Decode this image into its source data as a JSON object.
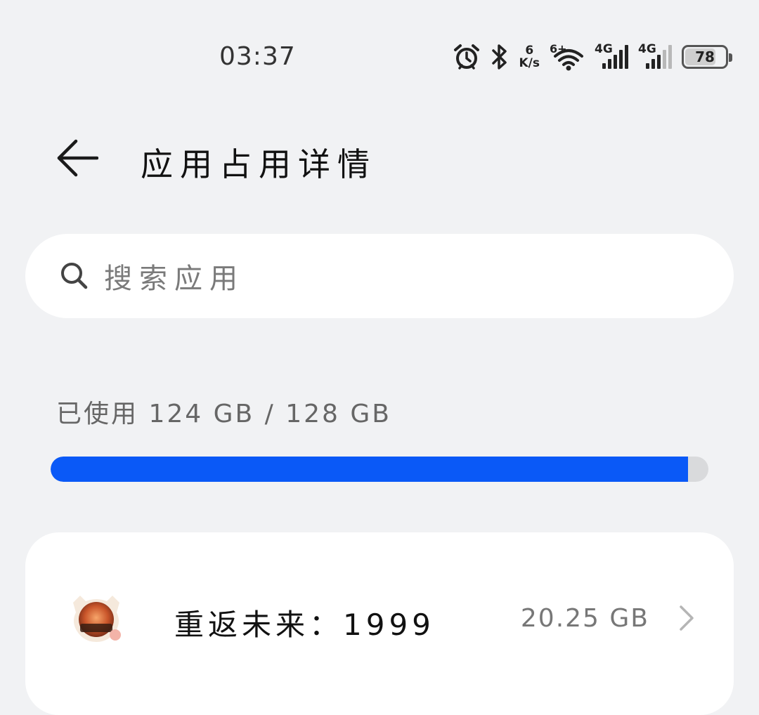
{
  "status_bar": {
    "time": "03:37",
    "net_speed_value": "6",
    "net_speed_unit": "K/s",
    "wifi_label": "6+",
    "sim1_label": "4G",
    "sim2_label": "4G",
    "battery_level": "78",
    "icons": [
      "alarm-icon",
      "bluetooth-icon",
      "wifi-icon",
      "signal-icon",
      "battery-icon"
    ]
  },
  "header": {
    "title": "应用占用详情",
    "back_icon": "back-arrow-icon"
  },
  "search": {
    "placeholder": "搜索应用",
    "icon": "search-icon"
  },
  "storage": {
    "usage_label": "已使用 124 GB / 128 GB",
    "used_gb": 124,
    "total_gb": 128,
    "bar_color": "#0a59f7",
    "track_color": "#d9dadc"
  },
  "apps": [
    {
      "name": "重返未来：1999",
      "size": "20.25 GB",
      "icon": "app-icon-reverse-1999"
    }
  ]
}
